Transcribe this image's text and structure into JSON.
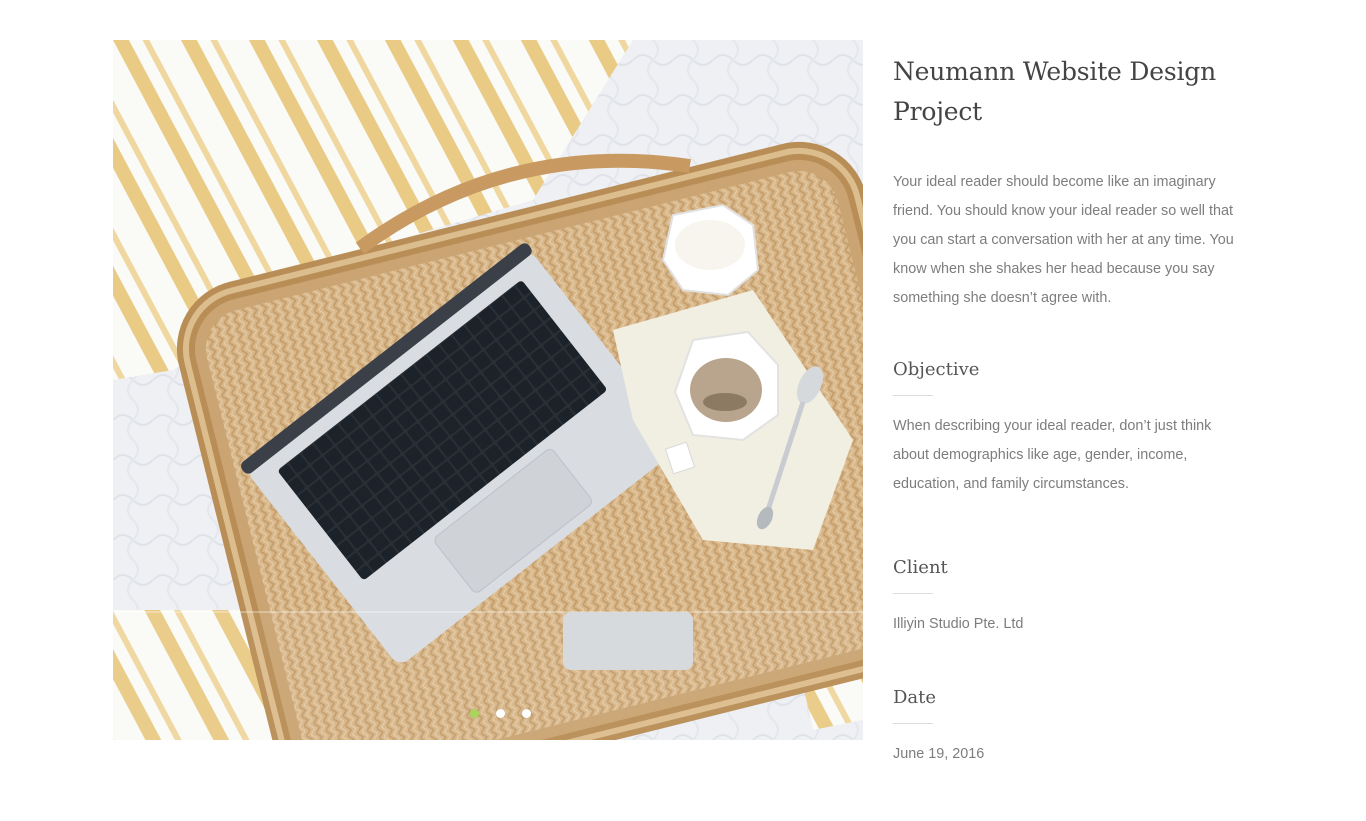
{
  "project": {
    "title": "Neumann Website Design Project",
    "description": "Your ideal reader should become like an imaginary friend. You should know your ideal reader so well that you can start a conversation with her at any time. You know when she shakes her head because you say something she doesn’t agree with."
  },
  "objective": {
    "heading": "Objective",
    "text": "When describing your ideal reader, don’t just think about demographics like age, gender, income, education, and family circumstances."
  },
  "client": {
    "heading": "Client",
    "text": "Illiyin Studio Pte. Ltd"
  },
  "date": {
    "heading": "Date",
    "text": "June 19, 2016"
  },
  "slider": {
    "slide_count": 3,
    "active_index": 0,
    "active_color": "#a8d65a",
    "inactive_color": "#ffffff"
  }
}
